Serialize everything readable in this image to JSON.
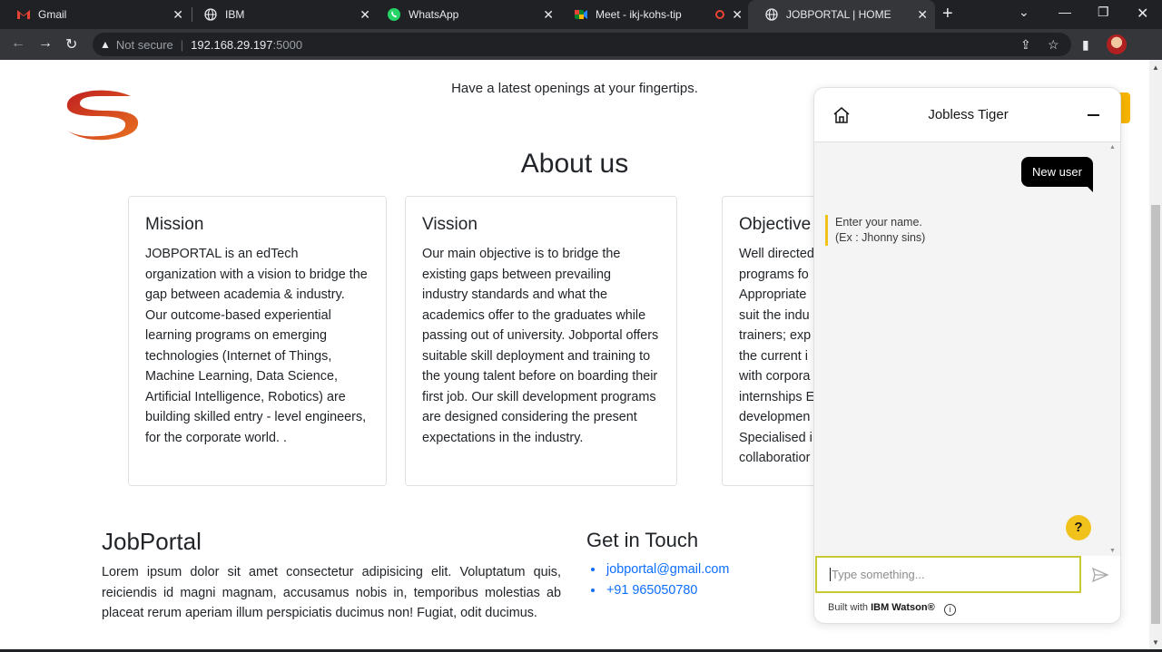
{
  "browser": {
    "tabs": [
      {
        "label": "Gmail",
        "icon": "gmail-icon"
      },
      {
        "label": "IBM",
        "icon": "globe-icon"
      },
      {
        "label": "WhatsApp",
        "icon": "whatsapp-icon"
      },
      {
        "label": "Meet - ikj-kohs-tip",
        "icon": "meet-icon"
      },
      {
        "label": "JOBPORTAL | HOME",
        "icon": "globe-icon"
      }
    ],
    "new_tab_label": "+",
    "address": {
      "security": "Not secure",
      "host": "192.168.29.197",
      "port": ":5000"
    }
  },
  "page": {
    "tagline": "Have a latest openings at your fingertips.",
    "about_title": "About us",
    "cards": [
      {
        "title": "Mission",
        "text": "JOBPORTAL is an edTech organization with a vision to bridge the gap between academia & industry. Our outcome-based experiential learning programs on emerging technologies (Internet of Things, Machine Learning, Data Science, Artificial Intelligence, Robotics) are building skilled entry - level engineers, for the corporate world. ."
      },
      {
        "title": "Vission",
        "text": "Our main objective is to bridge the existing gaps between prevailing industry standards and what the academics offer to the graduates while passing out of university. Jobportal offers suitable skill deployment and training to the young talent before on boarding their first job. Our skill development programs are designed considering the present expectations in the industry."
      },
      {
        "title": "Objective",
        "lines": [
          "Well directed",
          "programs fo",
          "Appropriate",
          "suit the indu",
          "trainers; exp",
          "the current i",
          "with corpora",
          "internships E",
          "developmen",
          "Specialised i",
          "collaboratior"
        ]
      }
    ],
    "jobportal_title": "JobPortal",
    "jobportal_text": "Lorem ipsum dolor sit amet consectetur adipisicing elit. Voluptatum quis, reiciendis id magni magnam, accusamus nobis in, temporibus molestias ab placeat rerum aperiam illum perspiciatis ducimus non! Fugiat, odit ducimus.",
    "contact_title": "Get in Touch",
    "contact_email": "jobportal@gmail.com",
    "contact_phone": "+91 965050780"
  },
  "chat": {
    "title": "Jobless Tiger",
    "user_message": "New user",
    "bot_message_line1": "Enter your name.",
    "bot_message_line2": "(Ex : Jhonny sins)",
    "help_label": "?",
    "input_placeholder": "Type something...",
    "footer_prefix": "Built with ",
    "footer_brand": "IBM Watson®",
    "info_label": "i"
  },
  "colors": {
    "accent_yellow": "#f1c21b",
    "link_blue": "#0d6efd",
    "chrome_dark": "#202124"
  }
}
